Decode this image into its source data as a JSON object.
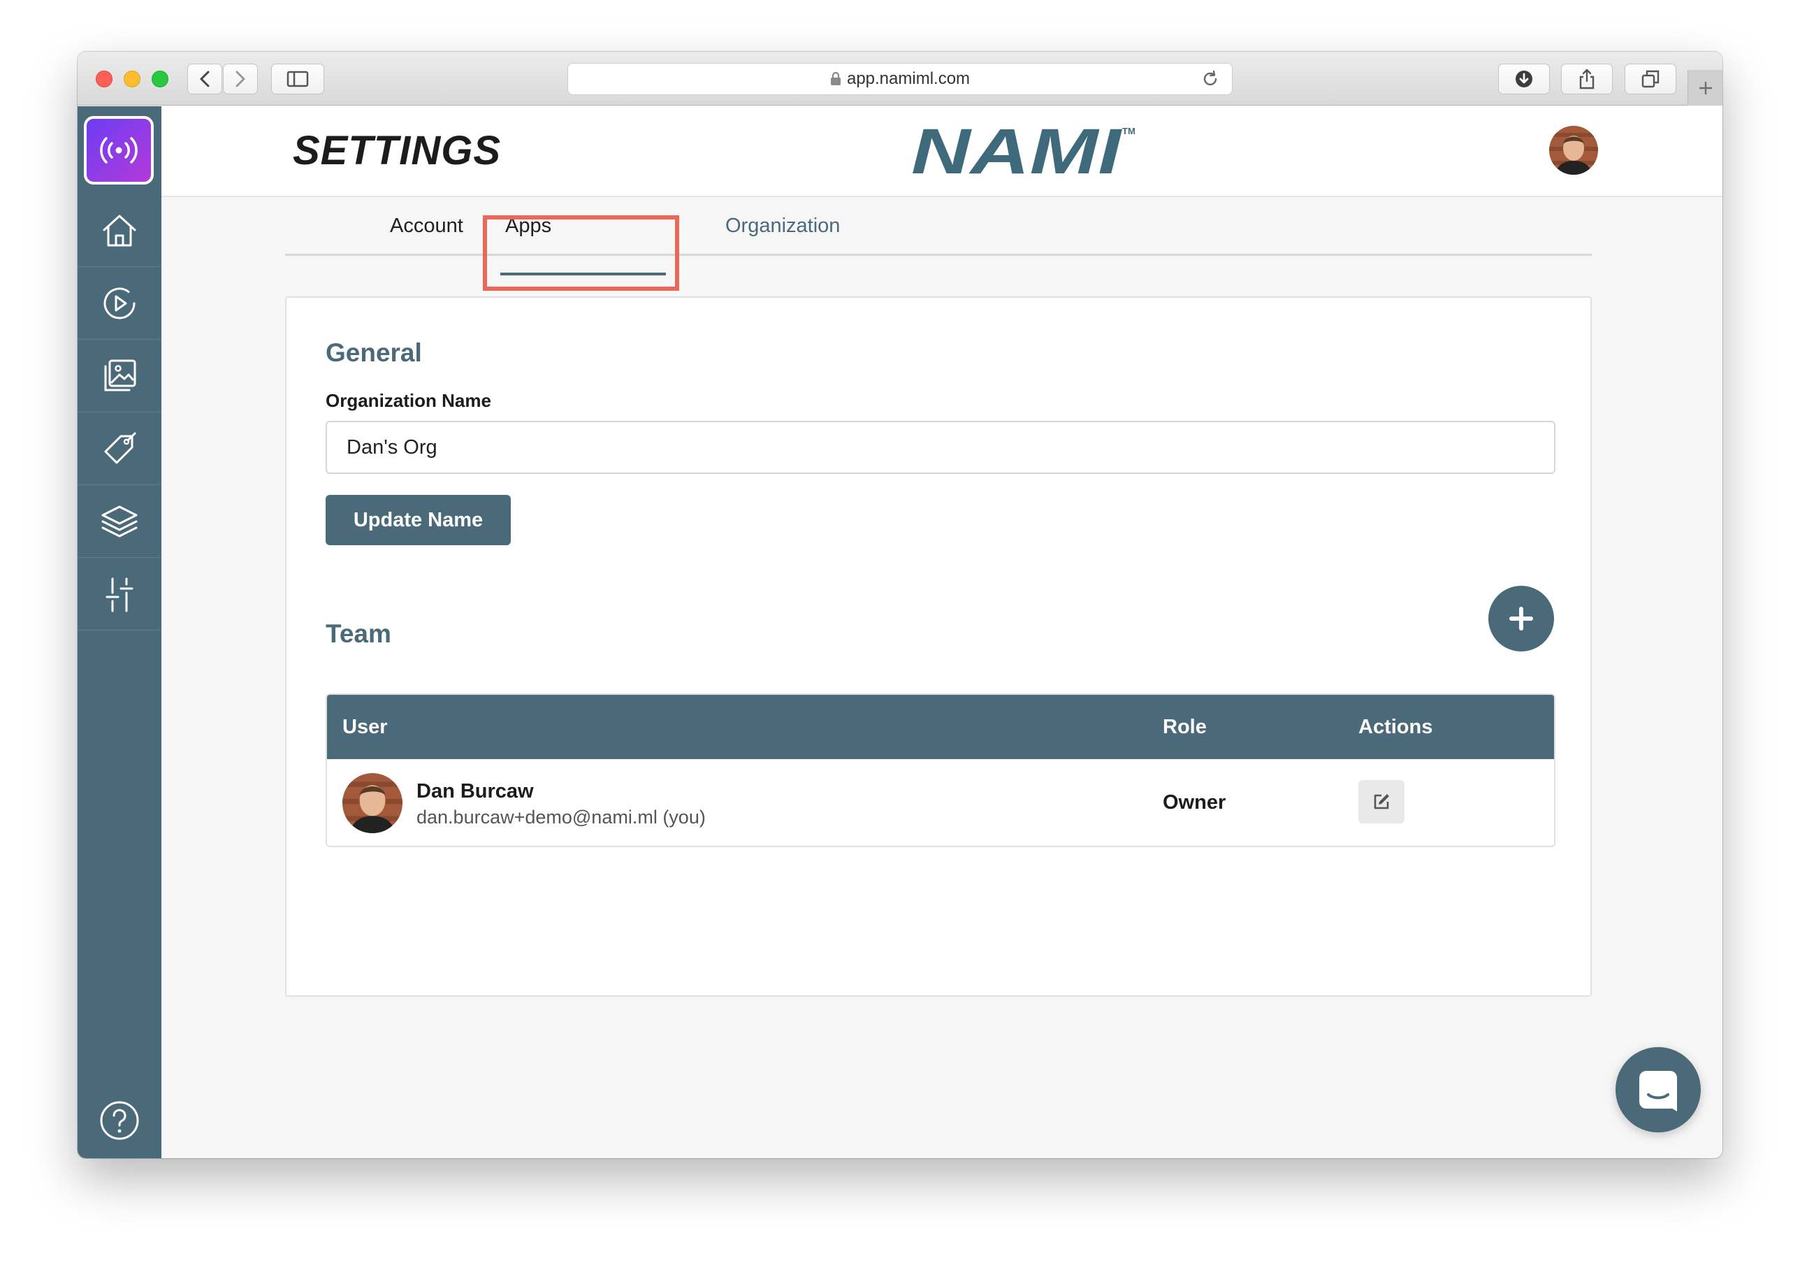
{
  "browser": {
    "url": "app.namiml.com"
  },
  "header": {
    "title": "SETTINGS",
    "logo_text": "NAMI",
    "logo_mark": "TM"
  },
  "tabs": [
    {
      "label": "Account",
      "active": false
    },
    {
      "label": "Apps",
      "active": false
    },
    {
      "label": "Organization",
      "active": true
    }
  ],
  "general": {
    "title": "General",
    "field_label": "Organization Name",
    "field_value": "Dan's Org",
    "button_label": "Update Name"
  },
  "team": {
    "title": "Team",
    "columns": [
      "User",
      "Role",
      "Actions"
    ],
    "rows": [
      {
        "name": "Dan Burcaw",
        "email": "dan.burcaw+demo@nami.ml (you)",
        "role": "Owner"
      }
    ]
  },
  "colors": {
    "primary": "#4a6979",
    "highlight": "#e8685a",
    "brand_gradient_start": "#6c3df2",
    "brand_gradient_end": "#b33ad9"
  },
  "sidebar": {
    "items": [
      "home-icon",
      "play-circle-icon",
      "image-gallery-icon",
      "tag-icon",
      "layers-icon",
      "sliders-icon"
    ],
    "help_icon": "help-icon"
  }
}
